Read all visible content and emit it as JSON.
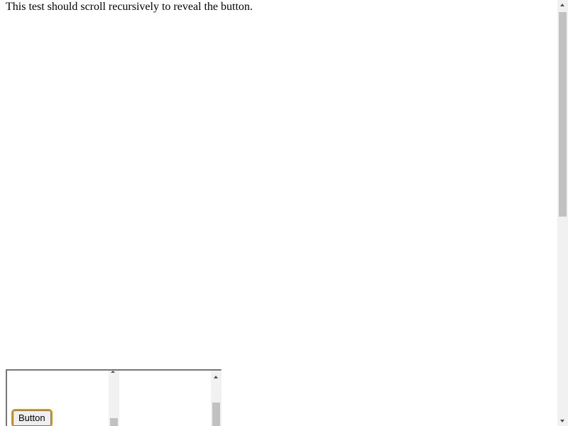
{
  "page": {
    "instruction": "This test should scroll recursively to reveal the button."
  },
  "target": {
    "button_label": "Button"
  },
  "colors": {
    "focus_ring": "#e59700",
    "scrollbar_thumb": "#c1c1c1",
    "scrollbar_track": "#f1f1f1"
  }
}
